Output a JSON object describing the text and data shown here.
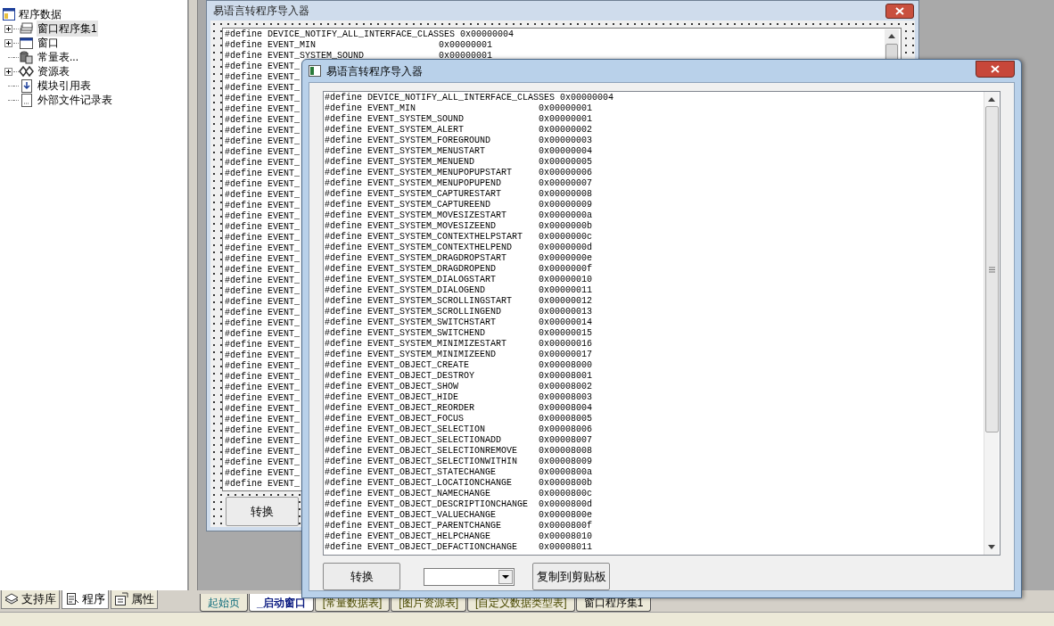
{
  "tree": {
    "label": "程序数据",
    "children": [
      {
        "label": "窗口程序集1",
        "expanded": false,
        "selected": true
      },
      {
        "label": "窗口",
        "expanded": false,
        "selected": false
      },
      {
        "label": "常量表...",
        "selected": false
      },
      {
        "label": "资源表",
        "expanded": false,
        "selected": false
      },
      {
        "label": "模块引用表",
        "selected": false
      },
      {
        "label": "外部文件记录表",
        "selected": false
      }
    ]
  },
  "panel_tabs": [
    {
      "label": "支持库",
      "selected": false
    },
    {
      "label": "程序",
      "selected": true
    },
    {
      "label": "属性",
      "selected": false
    }
  ],
  "editor_tabs": [
    {
      "label": "起始页",
      "kind": "start",
      "selected": false
    },
    {
      "label": "_启动窗口",
      "kind": "window",
      "selected": true
    },
    {
      "label": "[常量数据表]",
      "kind": "table",
      "selected": false
    },
    {
      "label": "[图片资源表]",
      "kind": "table",
      "selected": false
    },
    {
      "label": "[自定义数据类型表]",
      "kind": "table",
      "selected": false
    },
    {
      "label": "窗口程序集1",
      "kind": "window",
      "selected": false
    }
  ],
  "background_window": {
    "title": "易语言转程序导入器",
    "lines": [
      {
        "name": "#define DEVICE_NOTIFY_ALL_INTERFACE_CLASSES",
        "value": "0x00000004"
      },
      {
        "name": "#define EVENT_MIN",
        "value": "0x00000001"
      },
      {
        "name": "#define EVENT_SYSTEM_SOUND",
        "value": "0x00000001"
      },
      {
        "name": "#define EVENT_"
      },
      {
        "name": "#define EVENT_"
      },
      {
        "name": "#define EVENT_"
      },
      {
        "name": "#define EVENT_"
      },
      {
        "name": "#define EVENT_"
      },
      {
        "name": "#define EVENT_"
      },
      {
        "name": "#define EVENT_"
      },
      {
        "name": "#define EVENT_"
      },
      {
        "name": "#define EVENT_"
      },
      {
        "name": "#define EVENT_"
      },
      {
        "name": "#define EVENT_"
      },
      {
        "name": "#define EVENT_"
      },
      {
        "name": "#define EVENT_"
      },
      {
        "name": "#define EVENT_"
      },
      {
        "name": "#define EVENT_"
      },
      {
        "name": "#define EVENT_"
      },
      {
        "name": "#define EVENT_"
      },
      {
        "name": "#define EVENT_"
      },
      {
        "name": "#define EVENT_"
      },
      {
        "name": "#define EVENT_"
      },
      {
        "name": "#define EVENT_"
      },
      {
        "name": "#define EVENT_"
      },
      {
        "name": "#define EVENT_"
      },
      {
        "name": "#define EVENT_"
      },
      {
        "name": "#define EVENT_"
      },
      {
        "name": "#define EVENT_"
      },
      {
        "name": "#define EVENT_"
      },
      {
        "name": "#define EVENT_"
      },
      {
        "name": "#define EVENT_"
      },
      {
        "name": "#define EVENT_"
      },
      {
        "name": "#define EVENT_"
      },
      {
        "name": "#define EVENT_"
      },
      {
        "name": "#define EVENT_"
      },
      {
        "name": "#define EVENT_"
      },
      {
        "name": "#define EVENT_"
      },
      {
        "name": "#define EVENT_"
      },
      {
        "name": "#define EVENT_"
      },
      {
        "name": "#define EVENT_"
      },
      {
        "name": "#define EVENT_"
      },
      {
        "name": "#define EVENT_"
      }
    ],
    "button": "转换"
  },
  "dialog": {
    "title": "易语言转程序导入器",
    "lines": [
      {
        "name": "#define DEVICE_NOTIFY_ALL_INTERFACE_CLASSES",
        "value": "0x00000004"
      },
      {
        "name": "#define EVENT_MIN",
        "value": "0x00000001"
      },
      {
        "name": "#define EVENT_SYSTEM_SOUND",
        "value": "0x00000001"
      },
      {
        "name": "#define EVENT_SYSTEM_ALERT",
        "value": "0x00000002"
      },
      {
        "name": "#define EVENT_SYSTEM_FOREGROUND",
        "value": "0x00000003"
      },
      {
        "name": "#define EVENT_SYSTEM_MENUSTART",
        "value": "0x00000004"
      },
      {
        "name": "#define EVENT_SYSTEM_MENUEND",
        "value": "0x00000005"
      },
      {
        "name": "#define EVENT_SYSTEM_MENUPOPUPSTART",
        "value": "0x00000006"
      },
      {
        "name": "#define EVENT_SYSTEM_MENUPOPUPEND",
        "value": "0x00000007"
      },
      {
        "name": "#define EVENT_SYSTEM_CAPTURESTART",
        "value": "0x00000008"
      },
      {
        "name": "#define EVENT_SYSTEM_CAPTUREEND",
        "value": "0x00000009"
      },
      {
        "name": "#define EVENT_SYSTEM_MOVESIZESTART",
        "value": "0x0000000a"
      },
      {
        "name": "#define EVENT_SYSTEM_MOVESIZEEND",
        "value": "0x0000000b"
      },
      {
        "name": "#define EVENT_SYSTEM_CONTEXTHELPSTART",
        "value": "0x0000000c"
      },
      {
        "name": "#define EVENT_SYSTEM_CONTEXTHELPEND",
        "value": "0x0000000d"
      },
      {
        "name": "#define EVENT_SYSTEM_DRAGDROPSTART",
        "value": "0x0000000e"
      },
      {
        "name": "#define EVENT_SYSTEM_DRAGDROPEND",
        "value": "0x0000000f"
      },
      {
        "name": "#define EVENT_SYSTEM_DIALOGSTART",
        "value": "0x00000010"
      },
      {
        "name": "#define EVENT_SYSTEM_DIALOGEND",
        "value": "0x00000011"
      },
      {
        "name": "#define EVENT_SYSTEM_SCROLLINGSTART",
        "value": "0x00000012"
      },
      {
        "name": "#define EVENT_SYSTEM_SCROLLINGEND",
        "value": "0x00000013"
      },
      {
        "name": "#define EVENT_SYSTEM_SWITCHSTART",
        "value": "0x00000014"
      },
      {
        "name": "#define EVENT_SYSTEM_SWITCHEND",
        "value": "0x00000015"
      },
      {
        "name": "#define EVENT_SYSTEM_MINIMIZESTART",
        "value": "0x00000016"
      },
      {
        "name": "#define EVENT_SYSTEM_MINIMIZEEND",
        "value": "0x00000017"
      },
      {
        "name": "#define EVENT_OBJECT_CREATE",
        "value": "0x00008000"
      },
      {
        "name": "#define EVENT_OBJECT_DESTROY",
        "value": "0x00008001"
      },
      {
        "name": "#define EVENT_OBJECT_SHOW",
        "value": "0x00008002"
      },
      {
        "name": "#define EVENT_OBJECT_HIDE",
        "value": "0x00008003"
      },
      {
        "name": "#define EVENT_OBJECT_REORDER",
        "value": "0x00008004"
      },
      {
        "name": "#define EVENT_OBJECT_FOCUS",
        "value": "0x00008005"
      },
      {
        "name": "#define EVENT_OBJECT_SELECTION",
        "value": "0x00008006"
      },
      {
        "name": "#define EVENT_OBJECT_SELECTIONADD",
        "value": "0x00008007"
      },
      {
        "name": "#define EVENT_OBJECT_SELECTIONREMOVE",
        "value": "0x00008008"
      },
      {
        "name": "#define EVENT_OBJECT_SELECTIONWITHIN",
        "value": "0x00008009"
      },
      {
        "name": "#define EVENT_OBJECT_STATECHANGE",
        "value": "0x0000800a"
      },
      {
        "name": "#define EVENT_OBJECT_LOCATIONCHANGE",
        "value": "0x0000800b"
      },
      {
        "name": "#define EVENT_OBJECT_NAMECHANGE",
        "value": "0x0000800c"
      },
      {
        "name": "#define EVENT_OBJECT_DESCRIPTIONCHANGE",
        "value": "0x0000800d"
      },
      {
        "name": "#define EVENT_OBJECT_VALUECHANGE",
        "value": "0x0000800e"
      },
      {
        "name": "#define EVENT_OBJECT_PARENTCHANGE",
        "value": "0x0000800f"
      },
      {
        "name": "#define EVENT_OBJECT_HELPCHANGE",
        "value": "0x00008010"
      },
      {
        "name": "#define EVENT_OBJECT_DEFACTIONCHANGE",
        "value": "0x00008011"
      }
    ],
    "convert_button": "转换",
    "copy_button": "复制到剪贴板"
  }
}
